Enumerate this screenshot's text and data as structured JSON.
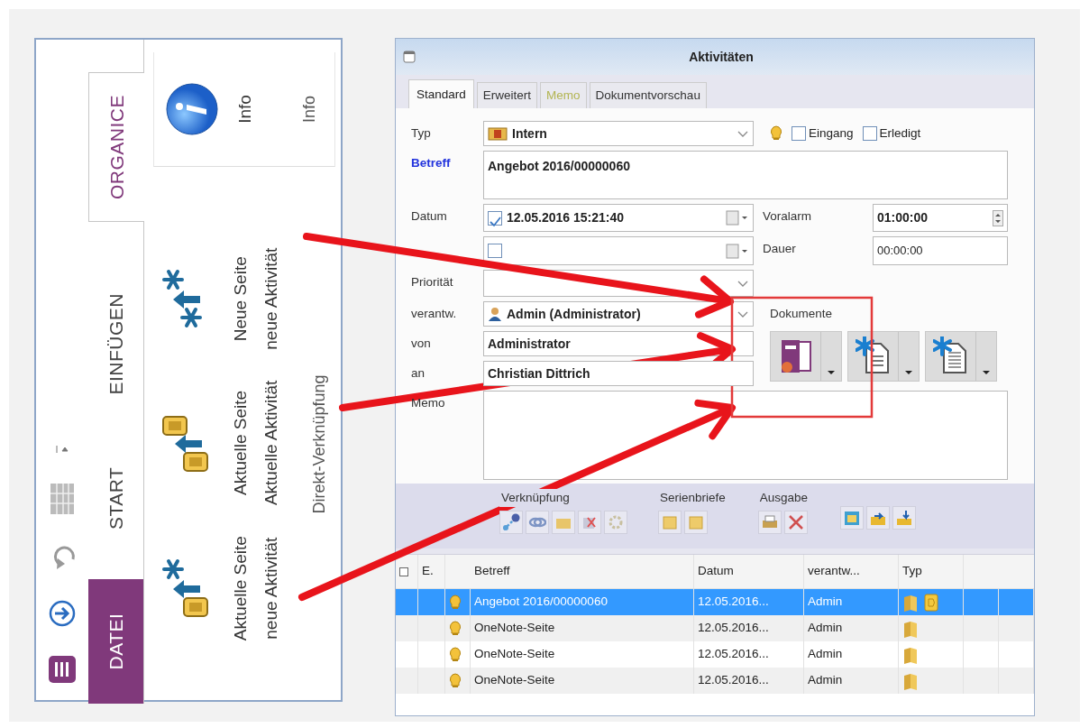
{
  "ribbon": {
    "quick_access": [
      {
        "kind": "app-logo"
      },
      {
        "kind": "download"
      },
      {
        "kind": "undo"
      },
      {
        "kind": "table"
      },
      {
        "kind": "customize"
      }
    ],
    "tabs": [
      {
        "label": "DATEI",
        "kind": "file",
        "selected": false
      },
      {
        "label": "START",
        "kind": "tab",
        "selected": false
      },
      {
        "label": "EINFÜGEN",
        "kind": "tab",
        "selected": false
      },
      {
        "label": "ORGANICE",
        "kind": "tab",
        "selected": true
      }
    ],
    "groups": [
      {
        "label": "Direkt-Verknüpfung",
        "buttons": [
          {
            "kind": "page-new-activity",
            "lines": [
              "Aktuelle Seite",
              "neue Aktivität"
            ]
          },
          {
            "kind": "page-current-activity",
            "lines": [
              "Aktuelle Seite",
              "Aktuelle Aktivität"
            ]
          },
          {
            "kind": "new-page-activity",
            "lines": [
              "Neue Seite",
              "neue Aktivität"
            ]
          }
        ]
      },
      {
        "label": "Info",
        "buttons": [
          {
            "kind": "info",
            "lines": [
              "Info"
            ]
          }
        ]
      }
    ]
  },
  "dialog": {
    "title": "Aktivitäten",
    "tabs": [
      {
        "label": "Standard",
        "selected": true,
        "color": "#222222"
      },
      {
        "label": "Erweitert",
        "selected": false,
        "color": "#333333"
      },
      {
        "label": "Memo",
        "selected": false,
        "color": "#b3b552"
      },
      {
        "label": "Dokumentvorschau",
        "selected": false,
        "color": "#333333"
      }
    ],
    "typ": {
      "label": "Typ",
      "value": "Intern"
    },
    "eingang": {
      "label": "Eingang",
      "checked": false
    },
    "erledigt": {
      "label": "Erledigt",
      "checked": false
    },
    "betreff": {
      "label": "Betreff",
      "value": "Angebot 2016/00000060"
    },
    "datum": {
      "label": "Datum",
      "checked": true,
      "value": "12.05.2016 15:21:40"
    },
    "datum_2": {
      "checked": false
    },
    "voralarm": {
      "label": "Voralarm",
      "value": "01:00:00"
    },
    "dauer": {
      "label": "Dauer",
      "value": "00:00:00"
    },
    "prioritaet": {
      "label": "Priorität"
    },
    "verantw": {
      "label": "verantw.",
      "value": "Admin (Administrator)"
    },
    "von": {
      "label": "von",
      "value": "Administrator"
    },
    "an": {
      "label": "an",
      "value": "Christian Dittrich"
    },
    "memo": {
      "label": "Memo"
    },
    "dokumente": {
      "label": "Dokumente",
      "buttons": [
        {
          "kind": "onenote"
        },
        {
          "kind": "new-document"
        },
        {
          "kind": "new-list-document"
        }
      ]
    },
    "toolbar": [
      {
        "label": "Verknüpfung",
        "buttons": [
          {
            "kind": "link"
          },
          {
            "kind": "chain"
          },
          {
            "kind": "folder"
          },
          {
            "kind": "delete"
          },
          {
            "kind": "gear"
          }
        ]
      },
      {
        "label": "Serienbriefe",
        "buttons": [
          {
            "kind": "letter"
          },
          {
            "kind": "letter"
          }
        ]
      },
      {
        "label": "Ausgabe",
        "buttons": [
          {
            "kind": "print"
          },
          {
            "kind": "tools"
          }
        ]
      },
      {
        "buttons": [
          {
            "kind": "calendar"
          },
          {
            "kind": "export"
          },
          {
            "kind": "import"
          }
        ]
      }
    ],
    "grid": {
      "columns": [
        "E.",
        "Betreff",
        "Datum",
        "verantw...",
        "Typ"
      ],
      "rows": [
        {
          "selected": true,
          "betreff": "Angebot 2016/00000060",
          "datum": "12.05.2016...",
          "verantw": "Admin",
          "attachment": true
        },
        {
          "selected": false,
          "betreff": "OneNote-Seite",
          "datum": "12.05.2016...",
          "verantw": "Admin",
          "attachment": false
        },
        {
          "selected": false,
          "betreff": "OneNote-Seite",
          "datum": "12.05.2016...",
          "verantw": "Admin",
          "attachment": false
        },
        {
          "selected": false,
          "betreff": "OneNote-Seite",
          "datum": "12.05.2016...",
          "verantw": "Admin",
          "attachment": false
        }
      ]
    }
  }
}
